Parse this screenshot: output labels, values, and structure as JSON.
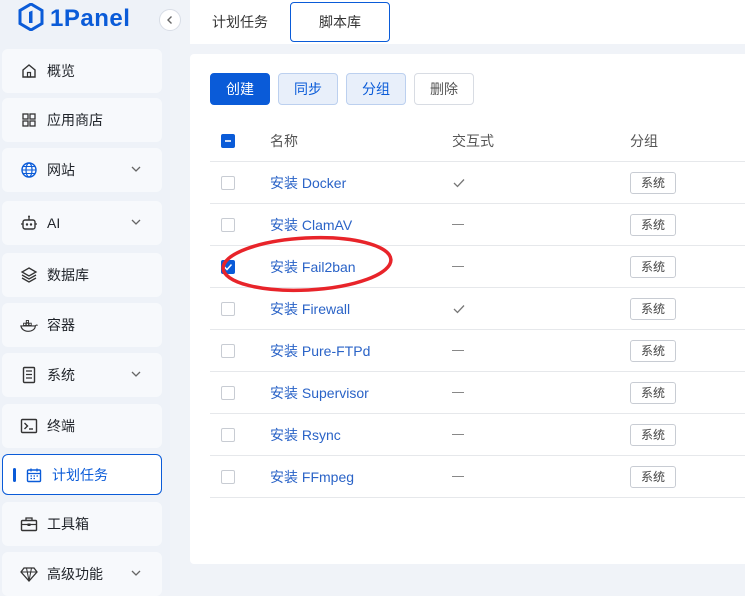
{
  "app": {
    "logo_text": "1Panel"
  },
  "sidebar": {
    "items": [
      {
        "label": "概览",
        "icon": "dashboard-icon",
        "chevron": false
      },
      {
        "label": "应用商店",
        "icon": "apps-grid-icon",
        "chevron": false
      },
      {
        "label": "网站",
        "icon": "globe-icon",
        "chevron": true
      },
      {
        "label": "AI",
        "icon": "robot-icon",
        "chevron": true
      },
      {
        "label": "数据库",
        "icon": "database-layers-icon",
        "chevron": false
      },
      {
        "label": "容器",
        "icon": "docker-whale-icon",
        "chevron": false
      },
      {
        "label": "系统",
        "icon": "server-icon",
        "chevron": true
      },
      {
        "label": "终端",
        "icon": "terminal-icon",
        "chevron": false
      },
      {
        "label": "计划任务",
        "icon": "calendar-icon",
        "chevron": false,
        "active": true
      },
      {
        "label": "工具箱",
        "icon": "toolbox-icon",
        "chevron": false
      },
      {
        "label": "高级功能",
        "icon": "diamond-icon",
        "chevron": true
      }
    ]
  },
  "tabs": [
    {
      "label": "计划任务",
      "active": false
    },
    {
      "label": "脚本库",
      "active": true
    }
  ],
  "toolbar": {
    "create": "创建",
    "sync": "同步",
    "group": "分组",
    "delete": "删除"
  },
  "table": {
    "headers": {
      "name": "名称",
      "interactive": "交互式",
      "group": "分组"
    },
    "rows": [
      {
        "name": "安装 Docker",
        "interactive": true,
        "group": "系统",
        "checked": false
      },
      {
        "name": "安装 ClamAV",
        "interactive": false,
        "group": "系统",
        "checked": false
      },
      {
        "name": "安装 Fail2ban",
        "interactive": false,
        "group": "系统",
        "checked": true
      },
      {
        "name": "安装 Firewall",
        "interactive": true,
        "group": "系统",
        "checked": false
      },
      {
        "name": "安装 Pure-FTPd",
        "interactive": false,
        "group": "系统",
        "checked": false
      },
      {
        "name": "安装 Supervisor",
        "interactive": false,
        "group": "系统",
        "checked": false
      },
      {
        "name": "安装 Rsync",
        "interactive": false,
        "group": "系统",
        "checked": false
      },
      {
        "name": "安装 FFmpeg",
        "interactive": false,
        "group": "系统",
        "checked": false
      }
    ]
  },
  "colors": {
    "accent": "#0a5bd8",
    "link": "#2a63c7",
    "annotation": "#e8242a"
  }
}
